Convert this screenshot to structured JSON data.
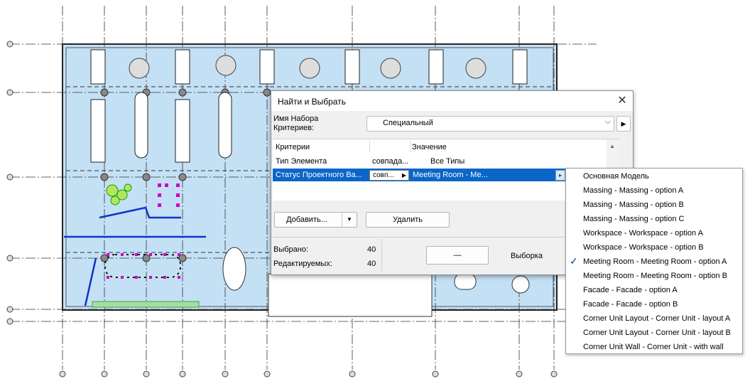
{
  "dialog": {
    "title": "Найти и Выбрать",
    "close_glyph": "✕",
    "criteria_set_label": "Имя Набора Критериев:",
    "criteria_set_value": "Специальный",
    "chevron_glyph": "⌵",
    "side_arrow_glyph": "▶",
    "columns": {
      "criteria": "Критерии",
      "value": "Значение"
    },
    "rows": [
      {
        "criterion": "Тип Элемента",
        "operator": "совпада...",
        "value": "Все Типы",
        "selected": false
      },
      {
        "criterion": "Статус Проектного Ва...",
        "operator": "совп...",
        "value": "Meeting Room - Me...",
        "selected": true
      }
    ],
    "row_arrow_glyph": "▸",
    "add_button": "Добавить...",
    "add_dropdown_glyph": "▼",
    "delete_button": "Удалить",
    "selected_label": "Выбрано:",
    "selected_count": "40",
    "editable_label": "Редактируемых:",
    "editable_count": "40",
    "deselect_button": "—",
    "selection_label": "Выборка",
    "scroll_up_glyph": "▲"
  },
  "menu": {
    "checked_index": 6,
    "check_glyph": "✓",
    "items": [
      "Основная Модель",
      "Massing - Massing - option A",
      "Massing - Massing - option B",
      "Massing - Massing - option C",
      "Workspace - Workspace - option A",
      "Workspace - Workspace - option B",
      "Meeting Room - Meeting Room - option A",
      "Meeting Room - Meeting Room - option B",
      "Facade - Facade - option A",
      "Facade - Facade - option B",
      "Corner Unit Layout - Corner Unit - layout A",
      "Corner Unit Layout - Corner Unit - layout B",
      "Corner Unit Wall - Corner Unit - with wall"
    ]
  },
  "colors": {
    "floor_fill": "#c4e0f5",
    "selection_highlight": "#0a66c8",
    "selected_element": "#cc00cc",
    "accent_green": "#66bb66"
  }
}
